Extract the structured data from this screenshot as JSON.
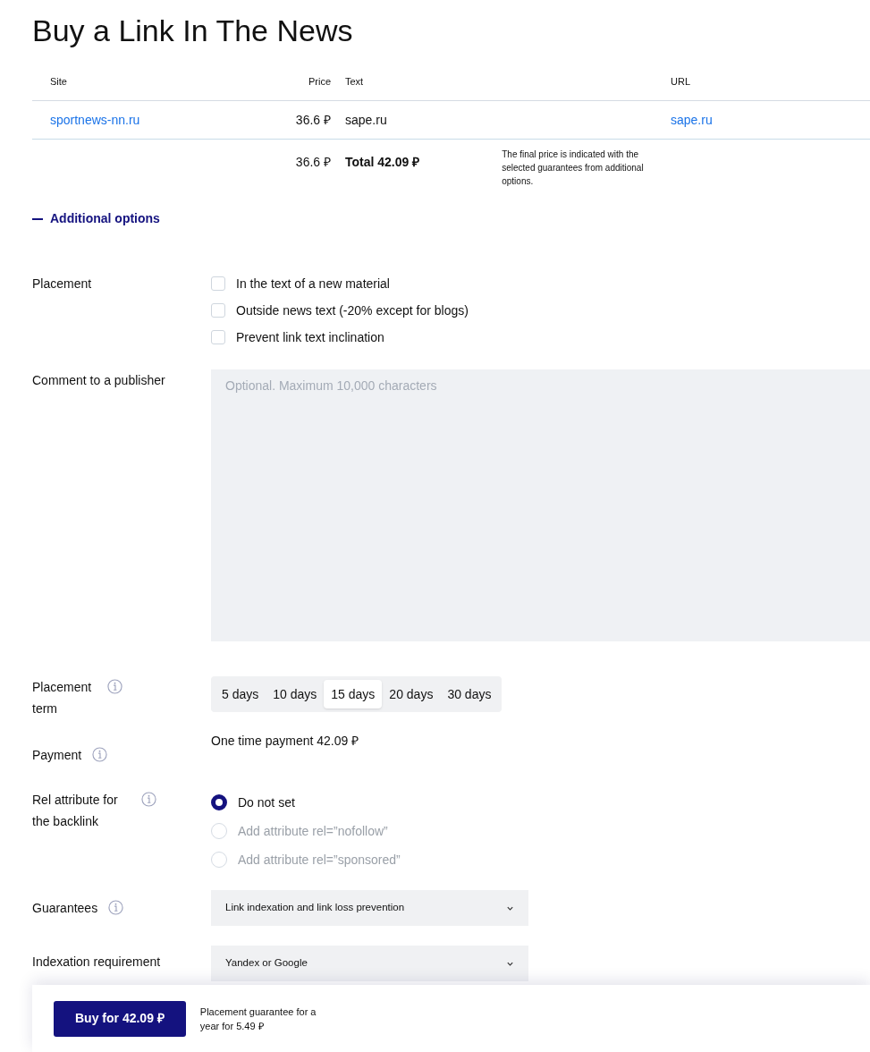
{
  "title": "Buy a Link In The News",
  "table": {
    "columns": [
      "Site",
      "Price",
      "Text",
      "URL"
    ],
    "rows": [
      {
        "site": "sportnews-nn.ru",
        "price": "36.6 ₽",
        "text": "sape.ru",
        "url": "sape.ru"
      }
    ],
    "summary": {
      "price": "36.6 ₽",
      "total": "Total 42.09 ₽",
      "note": "The final price is indicated with the selected guarantees from additional options."
    }
  },
  "additional_options": {
    "label": "Additional options",
    "expanded": true
  },
  "placement": {
    "label": "Placement",
    "options": [
      {
        "label": "In the text of a new material",
        "checked": false
      },
      {
        "label": "Outside news text (-20% except for blogs)",
        "checked": false
      },
      {
        "label": "Prevent link text inclination",
        "checked": false
      }
    ]
  },
  "comment": {
    "label": "Comment to a publisher",
    "placeholder": "Optional. Maximum 10,000 characters"
  },
  "placement_term": {
    "label": "Placement term",
    "info": true,
    "options": [
      {
        "label": "5 days",
        "selected": false
      },
      {
        "label": "10 days",
        "selected": false
      },
      {
        "label": "15 days",
        "selected": true
      },
      {
        "label": "20 days",
        "selected": false
      },
      {
        "label": "30 days",
        "selected": false
      }
    ]
  },
  "payment": {
    "label": "Payment",
    "info": true,
    "value": "One time payment 42.09 ₽"
  },
  "rel_attribute": {
    "label": "Rel attribute for the backlink",
    "info": true,
    "options": [
      {
        "label": "Do not set",
        "selected": true,
        "disabled": false
      },
      {
        "label": "Add attribute rel=”nofollow”",
        "selected": false,
        "disabled": true
      },
      {
        "label": "Add attribute rel=”sponsored”",
        "selected": false,
        "disabled": true
      }
    ]
  },
  "guarantees": {
    "label": "Guarantees",
    "info": true,
    "value": "Link indexation and link loss prevention"
  },
  "indexation": {
    "label": "Indexation requirement",
    "value": "Yandex or Google"
  },
  "footer": {
    "button": "Buy for 42.09 ₽",
    "note": "Placement guarantee for a year for 5.49 ₽"
  }
}
